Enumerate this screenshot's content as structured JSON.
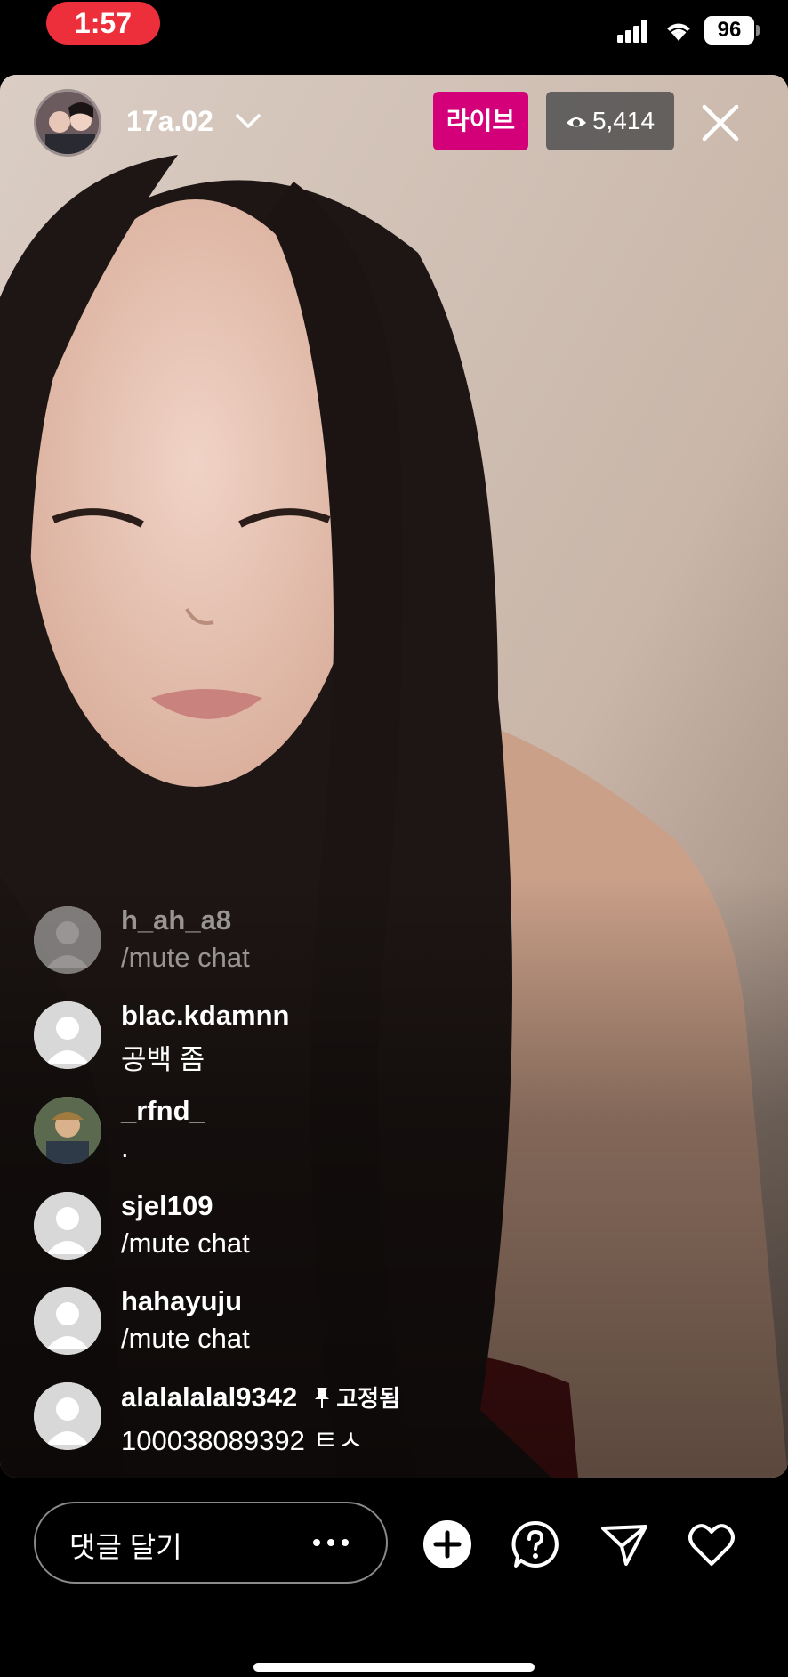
{
  "status_bar": {
    "time": "1:57",
    "battery": "96"
  },
  "live": {
    "host_name": "17a.02",
    "live_label": "라이브",
    "viewer_count": "5,414"
  },
  "comments": [
    {
      "user": "h_ah_a8",
      "text": "/mute chat",
      "avatar": "default"
    },
    {
      "user": "blac.kdamnn",
      "text": "공백 좀",
      "avatar": "default"
    },
    {
      "user": "_rfnd_",
      "text": ".",
      "avatar": "photo"
    },
    {
      "user": "sjel109",
      "text": "/mute chat",
      "avatar": "default"
    },
    {
      "user": "hahayuju",
      "text": "/mute chat",
      "avatar": "default"
    },
    {
      "user": "alalalalal9342",
      "text": "100038089392 ㅌㅅ",
      "avatar": "default",
      "pinned_label": "고정됨"
    }
  ],
  "bottom_bar": {
    "comment_placeholder": "댓글 달기",
    "icons": [
      "add-icon",
      "question-icon",
      "send-icon",
      "heart-icon"
    ]
  },
  "colors": {
    "live_badge": "#d3007a",
    "time_pill": "#ec2f3b"
  }
}
